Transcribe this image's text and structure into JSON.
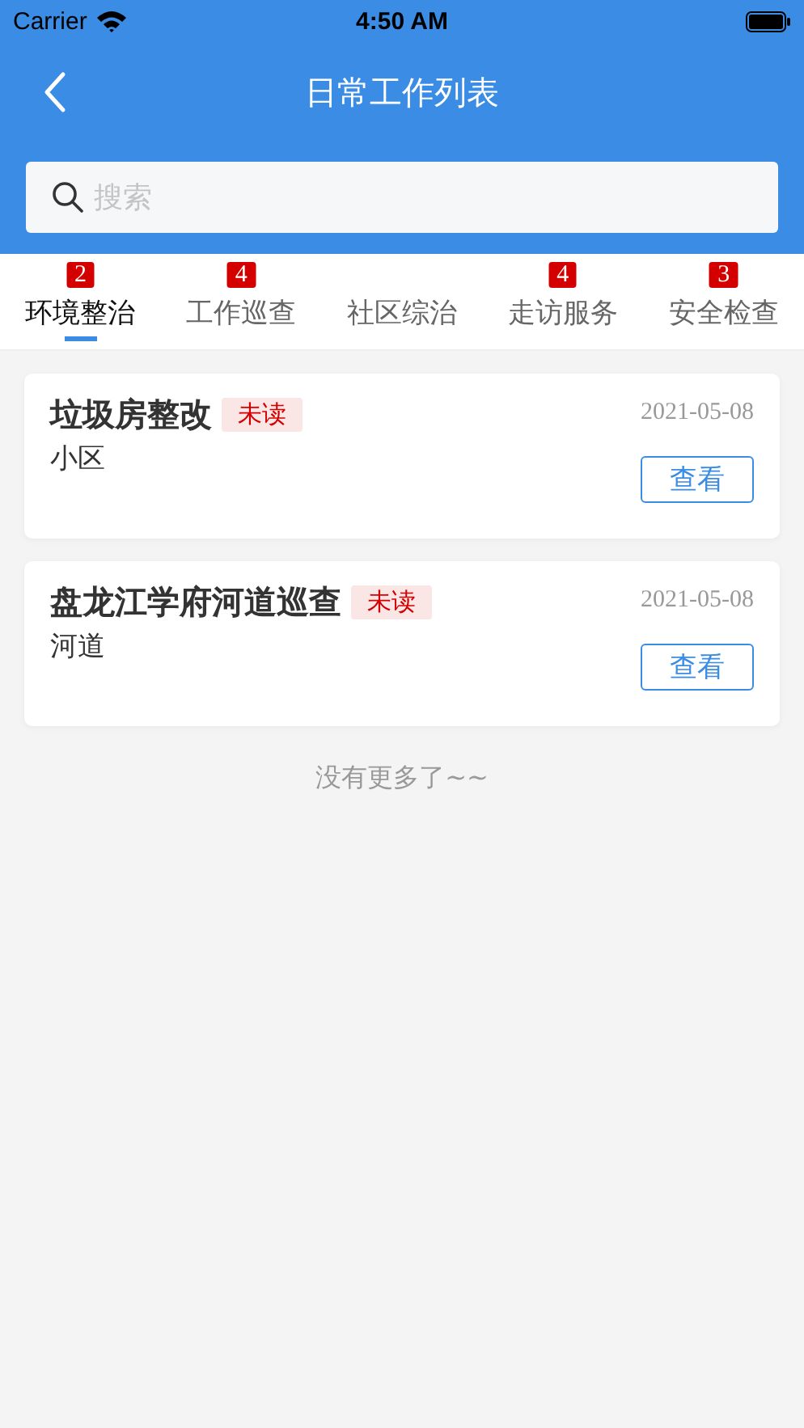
{
  "status_bar": {
    "carrier": "Carrier",
    "time": "4:50 AM"
  },
  "nav": {
    "title": "日常工作列表"
  },
  "search": {
    "placeholder": "搜索"
  },
  "tabs": [
    {
      "label": "环境整治",
      "badge": "2",
      "selected": true
    },
    {
      "label": "工作巡查",
      "badge": "4",
      "selected": false
    },
    {
      "label": "社区综治",
      "selected": false
    },
    {
      "label": "走访服务",
      "badge": "4",
      "selected": false
    },
    {
      "label": "安全检查",
      "badge": "3",
      "selected": false
    }
  ],
  "items": [
    {
      "title": "垃圾房整改",
      "tag": "未读",
      "unread": true,
      "date": "2021-05-08",
      "category": "小区",
      "button": "查看"
    },
    {
      "title": "盘龙江学府河道巡查",
      "tag": "未读",
      "unread": true,
      "date": "2021-05-08",
      "category": "河道",
      "button": "查看"
    }
  ],
  "footer": "没有更多了~~"
}
